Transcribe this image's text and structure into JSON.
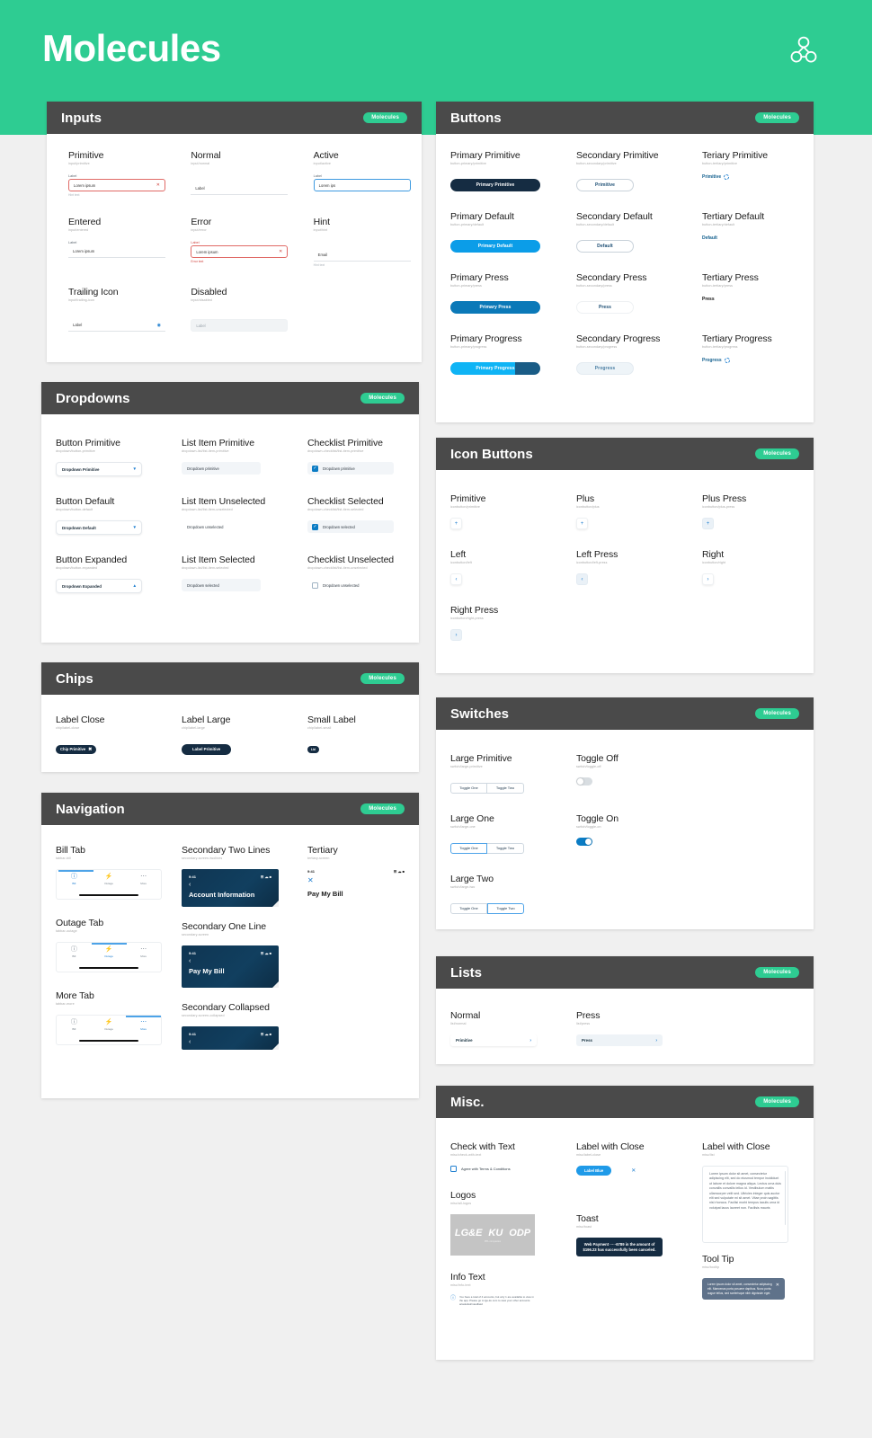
{
  "hero": {
    "title": "Molecules",
    "logo_icon": "molecule-logo-icon"
  },
  "badge_label": "Molecules",
  "panels": {
    "inputs": {
      "title": "Inputs",
      "items": [
        {
          "label": "Primitive",
          "path": "input/primitive",
          "field_label": "Label",
          "value": "Lorem ipsum",
          "hint": "Hint text",
          "state": "error-outline",
          "trailing": "clear-icon"
        },
        {
          "label": "Normal",
          "path": "input/normal",
          "field_label": "",
          "value": "Label",
          "hint": "",
          "state": "underline"
        },
        {
          "label": "Active",
          "path": "input/active",
          "field_label": "Label",
          "value": "Lorem ips",
          "hint": "",
          "state": "active"
        },
        {
          "label": "Entered",
          "path": "input/entered",
          "field_label": "Label",
          "value": "Lorem ipsum",
          "hint": "",
          "state": "underline"
        },
        {
          "label": "Error",
          "path": "input/error",
          "field_label": "Label",
          "value": "Lorem ipsum",
          "hint": "Error text",
          "state": "error",
          "trailing": "clear-icon"
        },
        {
          "label": "Hint",
          "path": "input/hint",
          "field_label": "",
          "value": "Email",
          "hint": "Hint text",
          "state": "underline"
        },
        {
          "label": "Trailing Icon",
          "path": "input/trailing-icon",
          "field_label": "",
          "value": "Label",
          "hint": "",
          "state": "underline",
          "trailing": "eye-icon"
        },
        {
          "label": "Disabled",
          "path": "input/disabled",
          "field_label": "",
          "value": "Label",
          "hint": "",
          "state": "disabled"
        }
      ]
    },
    "buttons": {
      "title": "Buttons",
      "items": [
        {
          "label": "Primary Primitive",
          "path": "button-primary/primitive",
          "btn_text": "Primary Primitive",
          "style": "prim-prim"
        },
        {
          "label": "Secondary Primitive",
          "path": "button-secondary/primitive",
          "btn_text": "Primitive",
          "style": "sec"
        },
        {
          "label": "Teriary Primitive",
          "path": "button-tertiary/primitive",
          "btn_text": "Primitive",
          "style": "tert-spin"
        },
        {
          "label": "Primary Default",
          "path": "button-primary/default",
          "btn_text": "Primary Default",
          "style": "prim-def"
        },
        {
          "label": "Secondary Default",
          "path": "button-secondary/default",
          "btn_text": "Default",
          "style": "sec"
        },
        {
          "label": "Tertiary Default",
          "path": "button-tertiary/default",
          "btn_text": "Default",
          "style": "tert"
        },
        {
          "label": "Primary Press",
          "path": "button-primary/press",
          "btn_text": "Primary Press",
          "style": "prim-press"
        },
        {
          "label": "Secondary Press",
          "path": "button-secondary/press",
          "btn_text": "Press",
          "style": "sec-press"
        },
        {
          "label": "Tertiary Press",
          "path": "button-tertiary/press",
          "btn_text": "Press",
          "style": "tert-dark"
        },
        {
          "label": "Primary Progress",
          "path": "button-primary/progress",
          "btn_text": "Primary Progress",
          "style": "prim-prog"
        },
        {
          "label": "Secondary Progress",
          "path": "button-secondary/progress",
          "btn_text": "Progress",
          "style": "sec-prog"
        },
        {
          "label": "Tertiary Progress",
          "path": "button-tertiary/progress",
          "btn_text": "Progress",
          "style": "tert-spin"
        }
      ]
    },
    "dropdowns": {
      "title": "Dropdowns",
      "items": [
        {
          "label": "Button Primitive",
          "path": "dropdown/button-primitive",
          "value": "Dropdown Primitive",
          "kind": "button",
          "caret": "chevron-down-icon"
        },
        {
          "label": "List Item Primitive",
          "path": "dropdown-list/list-item-primitive",
          "value": "Dropdown primitive",
          "kind": "list-filled"
        },
        {
          "label": "Checklist Primitive",
          "path": "dropdown-checklist/list-item-primitive",
          "value": "Dropdown primitive",
          "kind": "check-on"
        },
        {
          "label": "Button Default",
          "path": "dropdown/button-default",
          "value": "Dropdown Default",
          "kind": "button",
          "caret": "chevron-down-icon"
        },
        {
          "label": "List Item Unselected",
          "path": "dropdown-list/list-item-unselected",
          "value": "Dropdown unselected",
          "kind": "list-plain"
        },
        {
          "label": "Checklist Selected",
          "path": "dropdown-checklist/list-item-selected",
          "value": "Dropdown selected",
          "kind": "check-on"
        },
        {
          "label": "Button Expanded",
          "path": "dropdown/button-expanded",
          "value": "Dropdown Expanded",
          "kind": "button",
          "caret": "chevron-up-icon"
        },
        {
          "label": "List Item Selected",
          "path": "dropdown-list/list-item-selected",
          "value": "Dropdown selected",
          "kind": "list-filled"
        },
        {
          "label": "Checklist Unselected",
          "path": "dropdown-checklist/list-item-unselected",
          "value": "Dropdown unselected",
          "kind": "check-off"
        }
      ]
    },
    "icon_buttons": {
      "title": "Icon Buttons",
      "items": [
        {
          "label": "Primitive",
          "path": "iconbutton/primitive",
          "icon": "plus-icon",
          "glyph": "+",
          "press": false
        },
        {
          "label": "Plus",
          "path": "iconbutton/plus",
          "icon": "plus-icon",
          "glyph": "+",
          "press": false
        },
        {
          "label": "Plus Press",
          "path": "iconbutton/plus-press",
          "icon": "plus-icon",
          "glyph": "+",
          "press": true
        },
        {
          "label": "Left",
          "path": "iconbutton/left",
          "icon": "chevron-left-icon",
          "glyph": "‹",
          "press": false
        },
        {
          "label": "Left Press",
          "path": "iconbutton/left-press",
          "icon": "chevron-left-icon",
          "glyph": "‹",
          "press": true
        },
        {
          "label": "Right",
          "path": "iconbutton/right",
          "icon": "chevron-right-icon",
          "glyph": "›",
          "press": false
        },
        {
          "label": "Right Press",
          "path": "iconbutton/right-press",
          "icon": "chevron-right-icon",
          "glyph": "›",
          "press": true
        }
      ]
    },
    "chips": {
      "title": "Chips",
      "items": [
        {
          "label": "Label Close",
          "path": "chip/label-close",
          "chip_text": "Chip Primitive",
          "size": "sm-close",
          "close_icon": "close-circle-icon"
        },
        {
          "label": "Label Large",
          "path": "chip/label-large",
          "chip_text": "Label Primitive",
          "size": "lg"
        },
        {
          "label": "Small Label",
          "path": "chip/label-small",
          "chip_text": "Lbl",
          "size": "sm"
        }
      ]
    },
    "navigation": {
      "title": "Navigation",
      "tabs": [
        {
          "label": "Bill Tab",
          "path": "tabbar-bill",
          "active": 0
        },
        {
          "label": "Outage Tab",
          "path": "tabbar-outage",
          "active": 1
        },
        {
          "label": "More Tab",
          "path": "tabbar-more",
          "active": 2
        }
      ],
      "tab_items": [
        {
          "name": "Bill",
          "icon": "bill-icon"
        },
        {
          "name": "Outage",
          "icon": "outage-bolt-icon"
        },
        {
          "name": "More",
          "icon": "more-dots-icon"
        }
      ],
      "screens": [
        {
          "label": "Secondary Two Lines",
          "path": "secondary-screen-twolines",
          "time": "9:41",
          "title": "Account Information",
          "back_icon": "chevron-left-icon"
        },
        {
          "label": "Secondary One Line",
          "path": "secondary-screen",
          "time": "9:41",
          "title": "Pay My Bill",
          "back_icon": "chevron-left-icon"
        },
        {
          "label": "Secondary Collapsed",
          "path": "secondary-screen-collapsed",
          "time": "9:41",
          "title": "",
          "back_icon": "chevron-left-icon"
        }
      ],
      "tertiary": {
        "label": "Tertiary",
        "path": "tertiary-screen",
        "time": "9:41",
        "title": "Pay My Bill",
        "close_icon": "close-icon"
      }
    },
    "switches": {
      "title": "Switches",
      "items": [
        {
          "label": "Large Primitive",
          "path": "switch/large-primitive",
          "kind": "segment",
          "options": [
            "Toggle One",
            "Toggle Two"
          ],
          "selected": -1
        },
        {
          "label": "Toggle Off",
          "path": "switch/toggle-off",
          "kind": "toggle",
          "on": false
        },
        {
          "label": "Large One",
          "path": "switch/large-one",
          "kind": "segment",
          "options": [
            "Toggle One",
            "Toggle Two"
          ],
          "selected": 0
        },
        {
          "label": "Toggle On",
          "path": "switch/toggle-on",
          "kind": "toggle",
          "on": true
        },
        {
          "label": "Large Two",
          "path": "switch/large-two",
          "kind": "segment",
          "options": [
            "Toggle One",
            "Toggle Two"
          ],
          "selected": 1
        }
      ]
    },
    "lists": {
      "title": "Lists",
      "items": [
        {
          "label": "Normal",
          "path": "list/normal",
          "value": "Primitive",
          "press": false,
          "chevron": "chevron-right-icon"
        },
        {
          "label": "Press",
          "path": "list/press",
          "value": "Press",
          "press": true,
          "chevron": "chevron-right-icon"
        }
      ]
    },
    "misc": {
      "title": "Misc.",
      "check_with_text": {
        "label": "Check with Text",
        "path": "misc/check-with-text",
        "text": "Agree with Terms & Conditions"
      },
      "logos": {
        "label": "Logos",
        "path": "misc/all-logos",
        "marks": [
          "LG&E",
          "KU",
          "ODP"
        ],
        "sub": "PPL companies"
      },
      "info_text": {
        "label": "Info Text",
        "path": "misc/info-text",
        "icon": "info-circle-icon",
        "text": "You have a total of 4 accounts, but only 1 are available to view in the app. Please go to lge-ku.com to view your other accounts. ariaokdsofmasdfasd"
      },
      "label_with_close": {
        "label": "Label with Close",
        "path": "misc/label-close",
        "pill_text": "Label Blue",
        "close_icon": "close-icon"
      },
      "toast": {
        "label": "Toast",
        "path": "misc/toast",
        "text": "Web Payment ·····6789 in the amount of $196.23 has successfully been canceled."
      },
      "lorem_card": {
        "label": "Label with Close",
        "path": "misc/list",
        "text": "Lorem ipsum dolor sit amet, consectetur adipiscing elit, sed do eiusmod tempor incididunt ut labore et dolore magna aliqua. Lectus urna duis convallis convallis tellus id. Vestibulum mattis ullamcorper velit sed. Ultricies integer quis auctor elit sed vulputate mi sit amet. Vitae proin sagittis nisl rhoncus. Facilisi morbi tempus iaculis urna id volutpat lacus laoreet non. Facilisis mauris"
      },
      "tooltip": {
        "label": "Tool Tip",
        "path": "misc/tooltip",
        "text": "Lorem ipsum dolor sit amet, consectetur adipiscing elit. Maecenas porta posuere dapibus. Nunc porta augue tellus, sed scelerisque nibh dignissim eget.",
        "close_icon": "close-icon"
      }
    }
  }
}
